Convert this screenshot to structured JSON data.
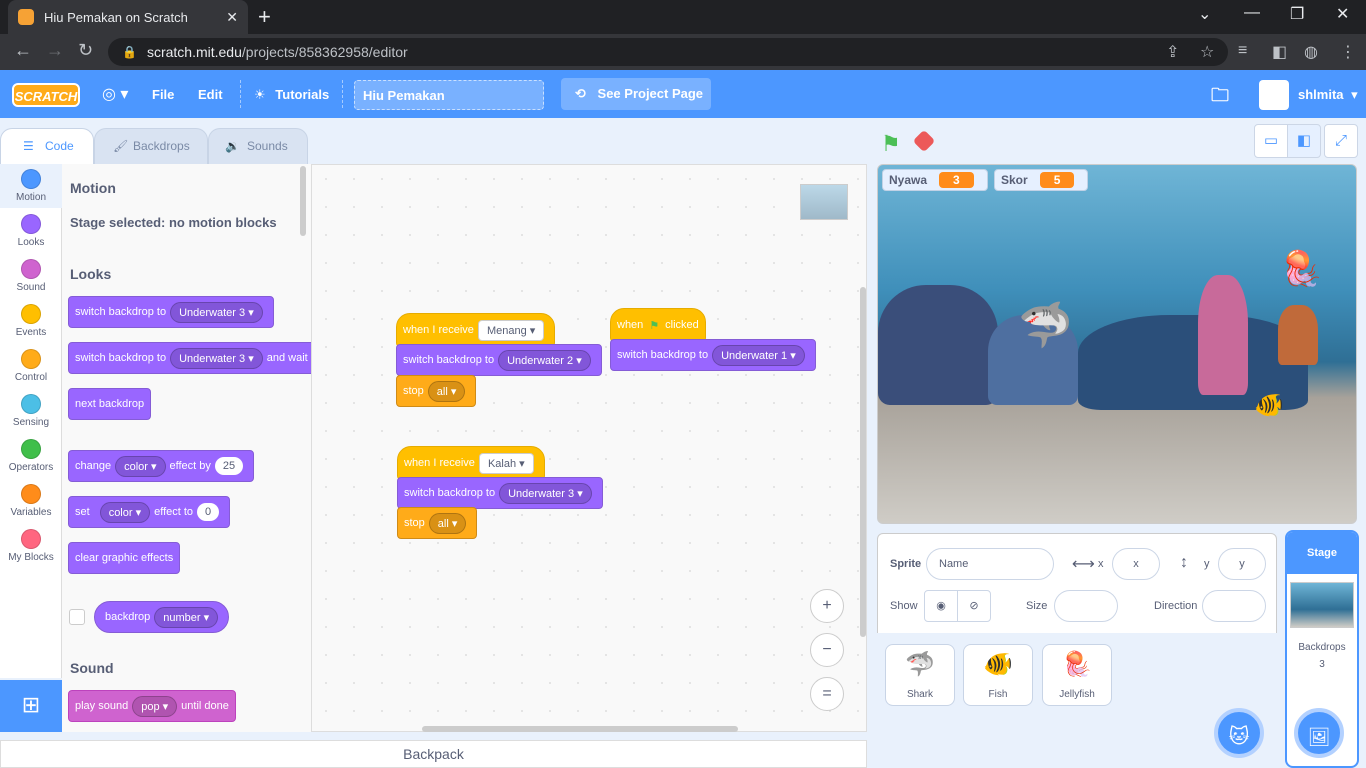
{
  "browser": {
    "tab_title": "Hiu Pemakan on Scratch",
    "tab_close": "✕",
    "new_tab": "+",
    "url_host": "scratch.mit.edu",
    "url_path": "/projects/858362958/editor",
    "controls": {
      "minimize": "—",
      "restore": "❐",
      "close": "✕",
      "tabsearch": "⌄"
    }
  },
  "menubar": {
    "logo": "SCRATCH",
    "file": "File",
    "edit": "Edit",
    "tutorials": "Tutorials",
    "project_title": "Hiu Pemakan",
    "see_project_page": "See Project Page",
    "username": "shlmita"
  },
  "editor_tabs": [
    "Code",
    "Backdrops",
    "Sounds"
  ],
  "categories": [
    {
      "label": "Motion",
      "color": "#4c97ff"
    },
    {
      "label": "Looks",
      "color": "#9966ff"
    },
    {
      "label": "Sound",
      "color": "#cf63cf"
    },
    {
      "label": "Events",
      "color": "#ffbf00"
    },
    {
      "label": "Control",
      "color": "#ffab19"
    },
    {
      "label": "Sensing",
      "color": "#4cbfe6"
    },
    {
      "label": "Operators",
      "color": "#40bf4a"
    },
    {
      "label": "Variables",
      "color": "#ff8c1a"
    },
    {
      "label": "My Blocks",
      "color": "#ff6680"
    }
  ],
  "palette": {
    "motion_heading": "Motion",
    "motion_note": "Stage selected: no motion blocks",
    "looks_heading": "Looks",
    "sound_heading": "Sound",
    "switch_backdrop_to": "switch backdrop to",
    "underwater3": "Underwater 3",
    "and_wait": "and wait",
    "next_backdrop": "next backdrop",
    "change": "change",
    "color": "color",
    "effect_by": "effect by",
    "effect_by_value": "25",
    "set": "set",
    "effect_to": "effect to",
    "effect_to_value": "0",
    "clear_graphic_effects": "clear graphic effects",
    "backdrop": "backdrop",
    "number": "number",
    "play_sound": "play sound",
    "pop": "pop",
    "until_done": "until done"
  },
  "scripts": {
    "when_i_receive": "when I receive",
    "menang": "Menang",
    "kalah": "Kalah",
    "switch_backdrop_to": "switch backdrop to",
    "underwater2": "Underwater 2",
    "underwater3": "Underwater 3",
    "underwater1": "Underwater 1",
    "stop": "stop",
    "all": "all",
    "when": "when",
    "clicked": "clicked"
  },
  "workspace": {
    "zoom_in": "+",
    "zoom_out": "−",
    "zoom_reset": "="
  },
  "backpack": "Backpack",
  "stage": {
    "monitors": [
      {
        "label": "Nyawa",
        "value": "3"
      },
      {
        "label": "Skor",
        "value": "5"
      }
    ]
  },
  "sprite_info": {
    "sprite_label": "Sprite",
    "name_placeholder": "Name",
    "x_label": "x",
    "x_placeholder": "x",
    "y_label": "y",
    "y_placeholder": "y",
    "show_label": "Show",
    "size_label": "Size",
    "direction_label": "Direction"
  },
  "sprites": [
    "Shark",
    "Fish",
    "Jellyfish"
  ],
  "stage_pane": {
    "title": "Stage",
    "backdrops_label": "Backdrops",
    "backdrops_count": "3"
  }
}
